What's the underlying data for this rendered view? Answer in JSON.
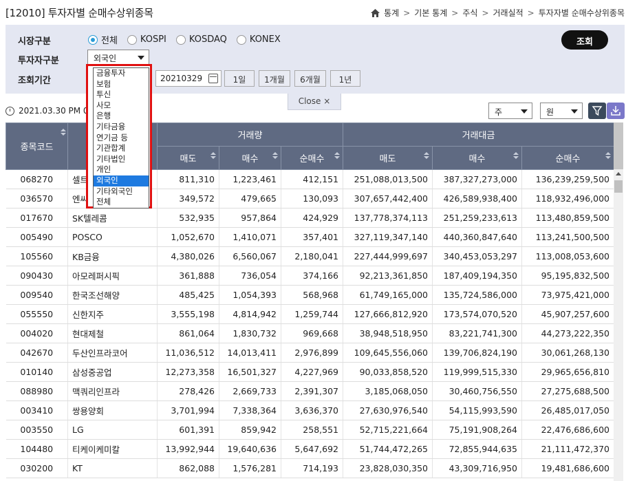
{
  "header": {
    "title": "[12010] 투자자별 순매수상위종목",
    "breadcrumb": [
      "통계",
      "기본 통계",
      "주식",
      "거래실적",
      "투자자별 순매수상위종목"
    ]
  },
  "search": {
    "market_label": "시장구분",
    "market_options": [
      "전체",
      "KOSPI",
      "KOSDAQ",
      "KONEX"
    ],
    "market_selected": "전체",
    "investor_label": "투자자구분",
    "investor_value": "외국인",
    "period_label": "조회기간",
    "date_end": "20210329",
    "period_buttons": [
      "1일",
      "1개월",
      "6개월",
      "1년"
    ],
    "search_button": "조회",
    "close_label": "Close ×"
  },
  "investor_dropdown": {
    "options": [
      "금융투자",
      "보험",
      "투신",
      "사모",
      "은행",
      "기타금융",
      "연기금 등",
      "기관합계",
      "기타법인",
      "개인",
      "외국인",
      "기타외국인",
      "전체"
    ],
    "selected": "외국인"
  },
  "toolbar": {
    "timestamp": "2021.03.30 PM 09",
    "unit_select1": "주",
    "unit_select2": "원"
  },
  "table": {
    "group_headers": {
      "code": "종목코드",
      "name": "",
      "volume": "거래량",
      "value": "거래대금"
    },
    "sub_headers": [
      "매도",
      "매수",
      "순매수",
      "매도",
      "매수",
      "순매수"
    ],
    "rows": [
      [
        "068270",
        "셀트",
        "811,310",
        "1,223,461",
        "412,151",
        "251,088,013,500",
        "387,327,273,000",
        "136,239,259,500"
      ],
      [
        "036570",
        "엔씨",
        "349,572",
        "479,665",
        "130,093",
        "307,657,442,400",
        "426,589,938,400",
        "118,932,496,000"
      ],
      [
        "017670",
        "SK텔레콤",
        "532,935",
        "957,864",
        "424,929",
        "137,778,374,113",
        "251,259,233,613",
        "113,480,859,500"
      ],
      [
        "005490",
        "POSCO",
        "1,052,670",
        "1,410,071",
        "357,401",
        "327,119,347,140",
        "440,360,847,640",
        "113,241,500,500"
      ],
      [
        "105560",
        "KB금융",
        "4,380,026",
        "6,560,067",
        "2,180,041",
        "227,444,999,697",
        "340,453,053,297",
        "113,008,053,600"
      ],
      [
        "090430",
        "아모레퍼시픽",
        "361,888",
        "736,054",
        "374,166",
        "92,213,361,850",
        "187,409,194,350",
        "95,195,832,500"
      ],
      [
        "009540",
        "한국조선해양",
        "485,425",
        "1,054,393",
        "568,968",
        "61,749,165,000",
        "135,724,586,000",
        "73,975,421,000"
      ],
      [
        "055550",
        "신한지주",
        "3,555,198",
        "4,814,942",
        "1,259,744",
        "127,666,812,920",
        "173,574,070,520",
        "45,907,257,600"
      ],
      [
        "004020",
        "현대제철",
        "861,064",
        "1,830,732",
        "969,668",
        "38,948,518,950",
        "83,221,741,300",
        "44,273,222,350"
      ],
      [
        "042670",
        "두산인프라코어",
        "11,036,512",
        "14,013,411",
        "2,976,899",
        "109,645,556,060",
        "139,706,824,190",
        "30,061,268,130"
      ],
      [
        "010140",
        "삼성중공업",
        "12,273,358",
        "16,501,327",
        "4,227,969",
        "90,033,858,520",
        "119,999,515,330",
        "29,965,656,810"
      ],
      [
        "088980",
        "맥쿼리인프라",
        "278,426",
        "2,669,733",
        "2,391,307",
        "3,185,068,050",
        "30,460,756,550",
        "27,275,688,500"
      ],
      [
        "003410",
        "쌍용양회",
        "3,701,994",
        "7,338,364",
        "3,636,370",
        "27,630,976,540",
        "54,115,993,590",
        "26,485,017,050"
      ],
      [
        "003550",
        "LG",
        "601,391",
        "859,942",
        "258,551",
        "52,715,221,664",
        "75,191,908,264",
        "22,476,686,600"
      ],
      [
        "104480",
        "티케이케미칼",
        "13,992,944",
        "19,640,636",
        "5,647,692",
        "51,744,472,265",
        "72,855,944,635",
        "21,111,472,370"
      ],
      [
        "030200",
        "KT",
        "862,088",
        "1,576,281",
        "714,193",
        "23,828,030,350",
        "43,309,716,950",
        "19,481,686,600"
      ]
    ]
  }
}
